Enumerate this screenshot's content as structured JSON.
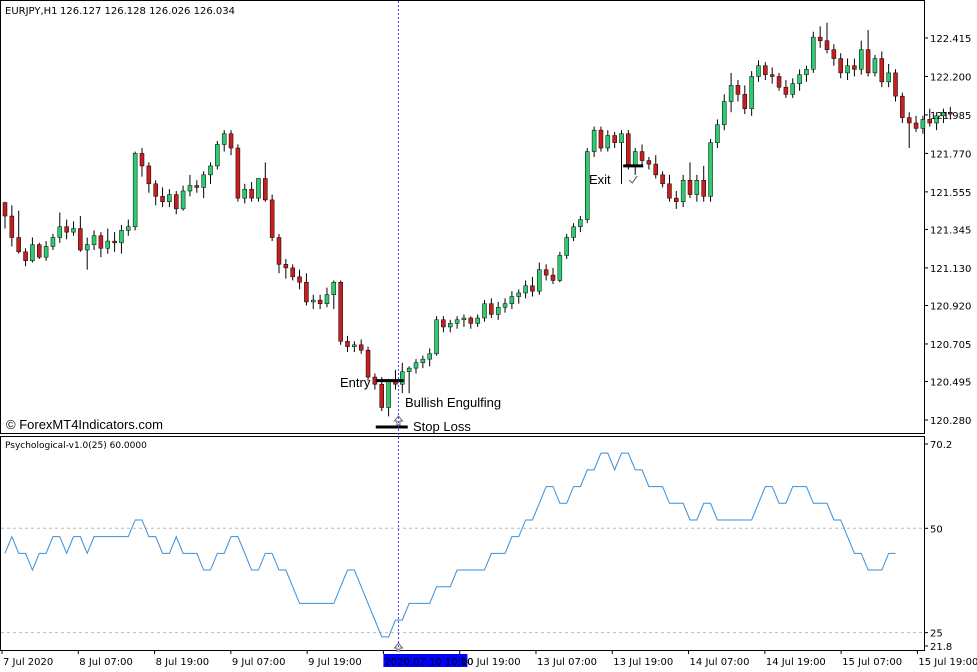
{
  "colors": {
    "background": "#ffffff",
    "bull": "#2ecc71",
    "bear": "#c81e1e",
    "wick": "#000000",
    "indicator": "#3a8fd9",
    "crosshair": "#3a3aff",
    "level": "#bbbbbb",
    "highlight": "#0000ff"
  },
  "header": {
    "symbol": "EURJPY,H1",
    "ohlc": "126.127 126.128 126.026 126.034"
  },
  "watermark": "© ForexMT4Indicators.com",
  "annotations": {
    "entry": "Entry",
    "exit": "Exit",
    "pattern": "Bullish Engulfing",
    "stop": "Stop Loss"
  },
  "indicator": {
    "title": "Psychological-v1.0(25) 60.0000"
  },
  "time_labels": [
    "7 Jul 2020",
    "8 Jul 07:00",
    "8 Jul 19:00",
    "9 Jul 07:00",
    "9 Jul 19:00",
    "2020.07.10 10:00",
    "10 Jul 19:00",
    "13 Jul 07:00",
    "13 Jul 19:00",
    "14 Jul 07:00",
    "14 Jul 19:00",
    "15 Jul 07:00",
    "15 Jul 19:00"
  ],
  "chart_data": [
    {
      "type": "candlestick",
      "symbol": "EURJPY",
      "timeframe": "H1",
      "price_ticks": [
        "122.415",
        "122.200",
        "121.985",
        "121.770",
        "121.555",
        "121.345",
        "121.130",
        "120.920",
        "120.705",
        "120.495",
        "120.280"
      ],
      "ylim": [
        120.25,
        122.54
      ],
      "candles": [
        {
          "o": 121.495,
          "h": 121.5,
          "l": 121.35,
          "c": 121.42
        },
        {
          "o": 121.42,
          "h": 121.48,
          "l": 121.25,
          "c": 121.3
        },
        {
          "o": 121.3,
          "h": 121.45,
          "l": 121.21,
          "c": 121.22
        },
        {
          "o": 121.22,
          "h": 121.24,
          "l": 121.14,
          "c": 121.17
        },
        {
          "o": 121.17,
          "h": 121.3,
          "l": 121.16,
          "c": 121.26
        },
        {
          "o": 121.26,
          "h": 121.27,
          "l": 121.18,
          "c": 121.19
        },
        {
          "o": 121.19,
          "h": 121.28,
          "l": 121.17,
          "c": 121.25
        },
        {
          "o": 121.25,
          "h": 121.32,
          "l": 121.23,
          "c": 121.3
        },
        {
          "o": 121.3,
          "h": 121.44,
          "l": 121.27,
          "c": 121.36
        },
        {
          "o": 121.36,
          "h": 121.4,
          "l": 121.29,
          "c": 121.33
        },
        {
          "o": 121.33,
          "h": 121.39,
          "l": 121.31,
          "c": 121.35
        },
        {
          "o": 121.35,
          "h": 121.42,
          "l": 121.22,
          "c": 121.23
        },
        {
          "o": 121.23,
          "h": 121.3,
          "l": 121.12,
          "c": 121.26
        },
        {
          "o": 121.26,
          "h": 121.34,
          "l": 121.23,
          "c": 121.31
        },
        {
          "o": 121.31,
          "h": 121.33,
          "l": 121.19,
          "c": 121.24
        },
        {
          "o": 121.24,
          "h": 121.35,
          "l": 121.21,
          "c": 121.28
        },
        {
          "o": 121.28,
          "h": 121.33,
          "l": 121.22,
          "c": 121.27
        },
        {
          "o": 121.27,
          "h": 121.37,
          "l": 121.21,
          "c": 121.34
        },
        {
          "o": 121.34,
          "h": 121.4,
          "l": 121.31,
          "c": 121.36
        },
        {
          "o": 121.36,
          "h": 121.78,
          "l": 121.34,
          "c": 121.77
        },
        {
          "o": 121.77,
          "h": 121.8,
          "l": 121.64,
          "c": 121.7
        },
        {
          "o": 121.7,
          "h": 121.72,
          "l": 121.55,
          "c": 121.6
        },
        {
          "o": 121.6,
          "h": 121.62,
          "l": 121.48,
          "c": 121.53
        },
        {
          "o": 121.53,
          "h": 121.58,
          "l": 121.47,
          "c": 121.5
        },
        {
          "o": 121.5,
          "h": 121.57,
          "l": 121.47,
          "c": 121.54
        },
        {
          "o": 121.54,
          "h": 121.56,
          "l": 121.43,
          "c": 121.46
        },
        {
          "o": 121.46,
          "h": 121.59,
          "l": 121.45,
          "c": 121.56
        },
        {
          "o": 121.56,
          "h": 121.65,
          "l": 121.53,
          "c": 121.59
        },
        {
          "o": 121.59,
          "h": 121.62,
          "l": 121.55,
          "c": 121.58
        },
        {
          "o": 121.58,
          "h": 121.67,
          "l": 121.52,
          "c": 121.65
        },
        {
          "o": 121.65,
          "h": 121.72,
          "l": 121.6,
          "c": 121.7
        },
        {
          "o": 121.7,
          "h": 121.84,
          "l": 121.68,
          "c": 121.82
        },
        {
          "o": 121.82,
          "h": 121.9,
          "l": 121.78,
          "c": 121.88
        },
        {
          "o": 121.88,
          "h": 121.9,
          "l": 121.76,
          "c": 121.8
        },
        {
          "o": 121.8,
          "h": 121.82,
          "l": 121.5,
          "c": 121.52
        },
        {
          "o": 121.52,
          "h": 121.6,
          "l": 121.49,
          "c": 121.57
        },
        {
          "o": 121.57,
          "h": 121.61,
          "l": 121.5,
          "c": 121.52
        },
        {
          "o": 121.52,
          "h": 121.63,
          "l": 121.5,
          "c": 121.63
        },
        {
          "o": 121.63,
          "h": 121.72,
          "l": 121.5,
          "c": 121.51
        },
        {
          "o": 121.51,
          "h": 121.54,
          "l": 121.28,
          "c": 121.3
        },
        {
          "o": 121.3,
          "h": 121.32,
          "l": 121.1,
          "c": 121.15
        },
        {
          "o": 121.15,
          "h": 121.18,
          "l": 121.07,
          "c": 121.13
        },
        {
          "o": 121.13,
          "h": 121.15,
          "l": 121.06,
          "c": 121.08
        },
        {
          "o": 121.08,
          "h": 121.12,
          "l": 121.01,
          "c": 121.05
        },
        {
          "o": 121.05,
          "h": 121.1,
          "l": 120.92,
          "c": 120.94
        },
        {
          "o": 120.94,
          "h": 120.98,
          "l": 120.9,
          "c": 120.95
        },
        {
          "o": 120.95,
          "h": 120.98,
          "l": 120.9,
          "c": 120.93
        },
        {
          "o": 120.93,
          "h": 121.02,
          "l": 120.91,
          "c": 120.98
        },
        {
          "o": 120.98,
          "h": 121.06,
          "l": 120.9,
          "c": 121.05
        },
        {
          "o": 121.05,
          "h": 121.06,
          "l": 120.7,
          "c": 120.72
        },
        {
          "o": 120.72,
          "h": 120.75,
          "l": 120.66,
          "c": 120.69
        },
        {
          "o": 120.69,
          "h": 120.72,
          "l": 120.66,
          "c": 120.7
        },
        {
          "o": 120.7,
          "h": 120.73,
          "l": 120.65,
          "c": 120.67
        },
        {
          "o": 120.67,
          "h": 120.69,
          "l": 120.5,
          "c": 120.52
        },
        {
          "o": 120.52,
          "h": 120.54,
          "l": 120.45,
          "c": 120.48
        },
        {
          "o": 120.48,
          "h": 120.52,
          "l": 120.33,
          "c": 120.35
        },
        {
          "o": 120.35,
          "h": 120.51,
          "l": 120.3,
          "c": 120.5
        },
        {
          "o": 120.5,
          "h": 120.56,
          "l": 120.45,
          "c": 120.48
        },
        {
          "o": 120.48,
          "h": 120.6,
          "l": 120.43,
          "c": 120.55
        },
        {
          "o": 120.55,
          "h": 120.58,
          "l": 120.43,
          "c": 120.57
        },
        {
          "o": 120.57,
          "h": 120.62,
          "l": 120.54,
          "c": 120.6
        },
        {
          "o": 120.6,
          "h": 120.64,
          "l": 120.57,
          "c": 120.62
        },
        {
          "o": 120.62,
          "h": 120.68,
          "l": 120.58,
          "c": 120.65
        },
        {
          "o": 120.65,
          "h": 120.86,
          "l": 120.64,
          "c": 120.84
        },
        {
          "o": 120.84,
          "h": 120.86,
          "l": 120.77,
          "c": 120.8
        },
        {
          "o": 120.8,
          "h": 120.84,
          "l": 120.77,
          "c": 120.82
        },
        {
          "o": 120.82,
          "h": 120.86,
          "l": 120.79,
          "c": 120.84
        },
        {
          "o": 120.84,
          "h": 120.87,
          "l": 120.8,
          "c": 120.85
        },
        {
          "o": 120.85,
          "h": 120.86,
          "l": 120.79,
          "c": 120.82
        },
        {
          "o": 120.82,
          "h": 120.87,
          "l": 120.8,
          "c": 120.85
        },
        {
          "o": 120.85,
          "h": 120.95,
          "l": 120.83,
          "c": 120.93
        },
        {
          "o": 120.93,
          "h": 120.96,
          "l": 120.85,
          "c": 120.87
        },
        {
          "o": 120.87,
          "h": 120.94,
          "l": 120.84,
          "c": 120.91
        },
        {
          "o": 120.91,
          "h": 120.96,
          "l": 120.88,
          "c": 120.93
        },
        {
          "o": 120.93,
          "h": 121.0,
          "l": 120.9,
          "c": 120.97
        },
        {
          "o": 120.97,
          "h": 121.01,
          "l": 120.93,
          "c": 120.99
        },
        {
          "o": 120.99,
          "h": 121.06,
          "l": 120.96,
          "c": 121.03
        },
        {
          "o": 121.03,
          "h": 121.08,
          "l": 120.97,
          "c": 121.0
        },
        {
          "o": 121.0,
          "h": 121.16,
          "l": 120.98,
          "c": 121.12
        },
        {
          "o": 121.12,
          "h": 121.15,
          "l": 121.06,
          "c": 121.09
        },
        {
          "o": 121.09,
          "h": 121.13,
          "l": 121.04,
          "c": 121.06
        },
        {
          "o": 121.06,
          "h": 121.22,
          "l": 121.05,
          "c": 121.2
        },
        {
          "o": 121.2,
          "h": 121.32,
          "l": 121.18,
          "c": 121.3
        },
        {
          "o": 121.3,
          "h": 121.38,
          "l": 121.28,
          "c": 121.36
        },
        {
          "o": 121.36,
          "h": 121.42,
          "l": 121.33,
          "c": 121.4
        },
        {
          "o": 121.4,
          "h": 121.8,
          "l": 121.38,
          "c": 121.78
        },
        {
          "o": 121.78,
          "h": 121.92,
          "l": 121.75,
          "c": 121.9
        },
        {
          "o": 121.9,
          "h": 121.92,
          "l": 121.78,
          "c": 121.8
        },
        {
          "o": 121.8,
          "h": 121.9,
          "l": 121.78,
          "c": 121.87
        },
        {
          "o": 121.87,
          "h": 121.89,
          "l": 121.8,
          "c": 121.83
        },
        {
          "o": 121.83,
          "h": 121.9,
          "l": 121.6,
          "c": 121.88
        },
        {
          "o": 121.88,
          "h": 121.9,
          "l": 121.68,
          "c": 121.7
        },
        {
          "o": 121.7,
          "h": 121.8,
          "l": 121.65,
          "c": 121.78
        },
        {
          "o": 121.78,
          "h": 121.82,
          "l": 121.7,
          "c": 121.73
        },
        {
          "o": 121.73,
          "h": 121.75,
          "l": 121.68,
          "c": 121.71
        },
        {
          "o": 121.71,
          "h": 121.76,
          "l": 121.63,
          "c": 121.65
        },
        {
          "o": 121.65,
          "h": 121.67,
          "l": 121.58,
          "c": 121.6
        },
        {
          "o": 121.6,
          "h": 121.65,
          "l": 121.5,
          "c": 121.52
        },
        {
          "o": 121.52,
          "h": 121.56,
          "l": 121.46,
          "c": 121.5
        },
        {
          "o": 121.5,
          "h": 121.65,
          "l": 121.47,
          "c": 121.62
        },
        {
          "o": 121.62,
          "h": 121.72,
          "l": 121.52,
          "c": 121.54
        },
        {
          "o": 121.54,
          "h": 121.65,
          "l": 121.5,
          "c": 121.62
        },
        {
          "o": 121.62,
          "h": 121.7,
          "l": 121.5,
          "c": 121.53
        },
        {
          "o": 121.53,
          "h": 121.85,
          "l": 121.5,
          "c": 121.83
        },
        {
          "o": 121.83,
          "h": 121.96,
          "l": 121.8,
          "c": 121.93
        },
        {
          "o": 121.93,
          "h": 122.1,
          "l": 121.9,
          "c": 122.06
        },
        {
          "o": 122.06,
          "h": 122.22,
          "l": 122.0,
          "c": 122.15
        },
        {
          "o": 122.15,
          "h": 122.18,
          "l": 122.06,
          "c": 122.1
        },
        {
          "o": 122.1,
          "h": 122.15,
          "l": 121.99,
          "c": 122.02
        },
        {
          "o": 122.02,
          "h": 122.23,
          "l": 121.98,
          "c": 122.2
        },
        {
          "o": 122.2,
          "h": 122.29,
          "l": 122.17,
          "c": 122.26
        },
        {
          "o": 122.26,
          "h": 122.28,
          "l": 122.18,
          "c": 122.21
        },
        {
          "o": 122.21,
          "h": 122.25,
          "l": 122.16,
          "c": 122.2
        },
        {
          "o": 122.2,
          "h": 122.22,
          "l": 122.12,
          "c": 122.14
        },
        {
          "o": 122.14,
          "h": 122.18,
          "l": 122.08,
          "c": 122.1
        },
        {
          "o": 122.1,
          "h": 122.19,
          "l": 122.08,
          "c": 122.16
        },
        {
          "o": 122.16,
          "h": 122.24,
          "l": 122.12,
          "c": 122.21
        },
        {
          "o": 122.21,
          "h": 122.26,
          "l": 122.17,
          "c": 122.24
        },
        {
          "o": 122.24,
          "h": 122.45,
          "l": 122.22,
          "c": 122.42
        },
        {
          "o": 122.42,
          "h": 122.48,
          "l": 122.36,
          "c": 122.4
        },
        {
          "o": 122.4,
          "h": 122.5,
          "l": 122.33,
          "c": 122.35
        },
        {
          "o": 122.35,
          "h": 122.38,
          "l": 122.26,
          "c": 122.3
        },
        {
          "o": 122.3,
          "h": 122.33,
          "l": 122.19,
          "c": 122.22
        },
        {
          "o": 122.22,
          "h": 122.3,
          "l": 122.18,
          "c": 122.26
        },
        {
          "o": 122.26,
          "h": 122.3,
          "l": 122.2,
          "c": 122.24
        },
        {
          "o": 122.24,
          "h": 122.4,
          "l": 122.21,
          "c": 122.35
        },
        {
          "o": 122.35,
          "h": 122.46,
          "l": 122.2,
          "c": 122.22
        },
        {
          "o": 122.22,
          "h": 122.32,
          "l": 122.2,
          "c": 122.3
        },
        {
          "o": 122.3,
          "h": 122.34,
          "l": 122.14,
          "c": 122.17
        },
        {
          "o": 122.17,
          "h": 122.27,
          "l": 122.14,
          "c": 122.22
        },
        {
          "o": 122.22,
          "h": 122.24,
          "l": 122.06,
          "c": 122.09
        },
        {
          "o": 122.09,
          "h": 122.11,
          "l": 121.94,
          "c": 121.97
        },
        {
          "o": 121.97,
          "h": 122.0,
          "l": 121.8,
          "c": 121.94
        },
        {
          "o": 121.94,
          "h": 121.98,
          "l": 121.89,
          "c": 121.91
        },
        {
          "o": 121.91,
          "h": 121.98,
          "l": 121.88,
          "c": 121.96
        },
        {
          "o": 121.96,
          "h": 122.02,
          "l": 121.92,
          "c": 121.94
        },
        {
          "o": 121.94,
          "h": 122.0,
          "l": 121.9,
          "c": 121.98
        },
        {
          "o": 121.98,
          "h": 122.02,
          "l": 121.94,
          "c": 122.0
        },
        {
          "o": 122.0,
          "h": 122.03,
          "l": 121.96,
          "c": 121.99
        }
      ],
      "markers": {
        "entry_candle_index": 55,
        "entry_price": 120.5,
        "stop_loss_price": 120.25,
        "exit_candle_index": 92,
        "exit_price": 121.7,
        "crosshair_candle_index": 57
      }
    },
    {
      "type": "line",
      "name": "Psychological-v1.0(25)",
      "level_ticks": [
        "70.2",
        "50",
        "25",
        "21.8"
      ],
      "level_lines": [
        50,
        25
      ],
      "ylim": [
        21.8,
        70.2
      ],
      "values": [
        44,
        48,
        44,
        44,
        40,
        44,
        44,
        48,
        48,
        44,
        48,
        48,
        44,
        48,
        48,
        48,
        48,
        48,
        48,
        52,
        52,
        48,
        48,
        44,
        44,
        48,
        44,
        44,
        44,
        40,
        40,
        44,
        44,
        48,
        48,
        44,
        40,
        40,
        44,
        44,
        40,
        40,
        36,
        32,
        32,
        32,
        32,
        32,
        32,
        36,
        40,
        40,
        36,
        32,
        28,
        24,
        24,
        28,
        28,
        32,
        32,
        32,
        32,
        36,
        36,
        36,
        40,
        40,
        40,
        40,
        40,
        44,
        44,
        44,
        48,
        48,
        52,
        52,
        56,
        60,
        60,
        56,
        56,
        60,
        60,
        64,
        64,
        68,
        68,
        64,
        68,
        68,
        64,
        64,
        60,
        60,
        60,
        56,
        56,
        56,
        52,
        52,
        56,
        56,
        52,
        52,
        52,
        52,
        52,
        52,
        56,
        60,
        60,
        56,
        56,
        60,
        60,
        60,
        56,
        56,
        56,
        52,
        52,
        48,
        44,
        44,
        40,
        40,
        40,
        44,
        44
      ]
    }
  ]
}
